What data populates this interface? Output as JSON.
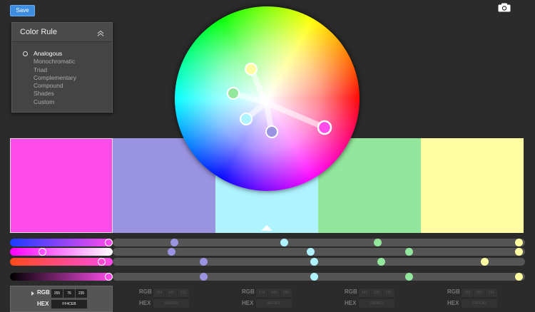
{
  "toolbar": {
    "save_label": "Save",
    "camera_icon": "camera-icon"
  },
  "color_rule": {
    "title": "Color Rule",
    "selected": "Analogous",
    "items": [
      "Analogous",
      "Monochromatic",
      "Triad",
      "Complementary",
      "Compound",
      "Shades",
      "Custom"
    ]
  },
  "swatches": [
    {
      "hex_color": "#ff4ceb",
      "rgb": [
        "255",
        "76",
        "235"
      ],
      "hex": "FF4CEB"
    },
    {
      "hex_color": "#9a93e0",
      "rgb": [
        "154",
        "147",
        "232"
      ],
      "hex": "9A93EB"
    },
    {
      "hex_color": "#aef3ff",
      "rgb": [
        "174",
        "243",
        "255"
      ],
      "hex": "AEF3FF"
    },
    {
      "hex_color": "#93e79d",
      "rgb": [
        "147",
        "232",
        "157"
      ],
      "hex": "93E89D"
    },
    {
      "hex_color": "#fffca1",
      "rgb": [
        "255",
        "252",
        "161"
      ],
      "hex": "FFFCA1"
    }
  ],
  "labels": {
    "rgb": "RGB",
    "hex": "HEX"
  },
  "colors": {
    "accent": "#3d8de0",
    "background": "#2b2b2b",
    "panel": "#444444"
  }
}
